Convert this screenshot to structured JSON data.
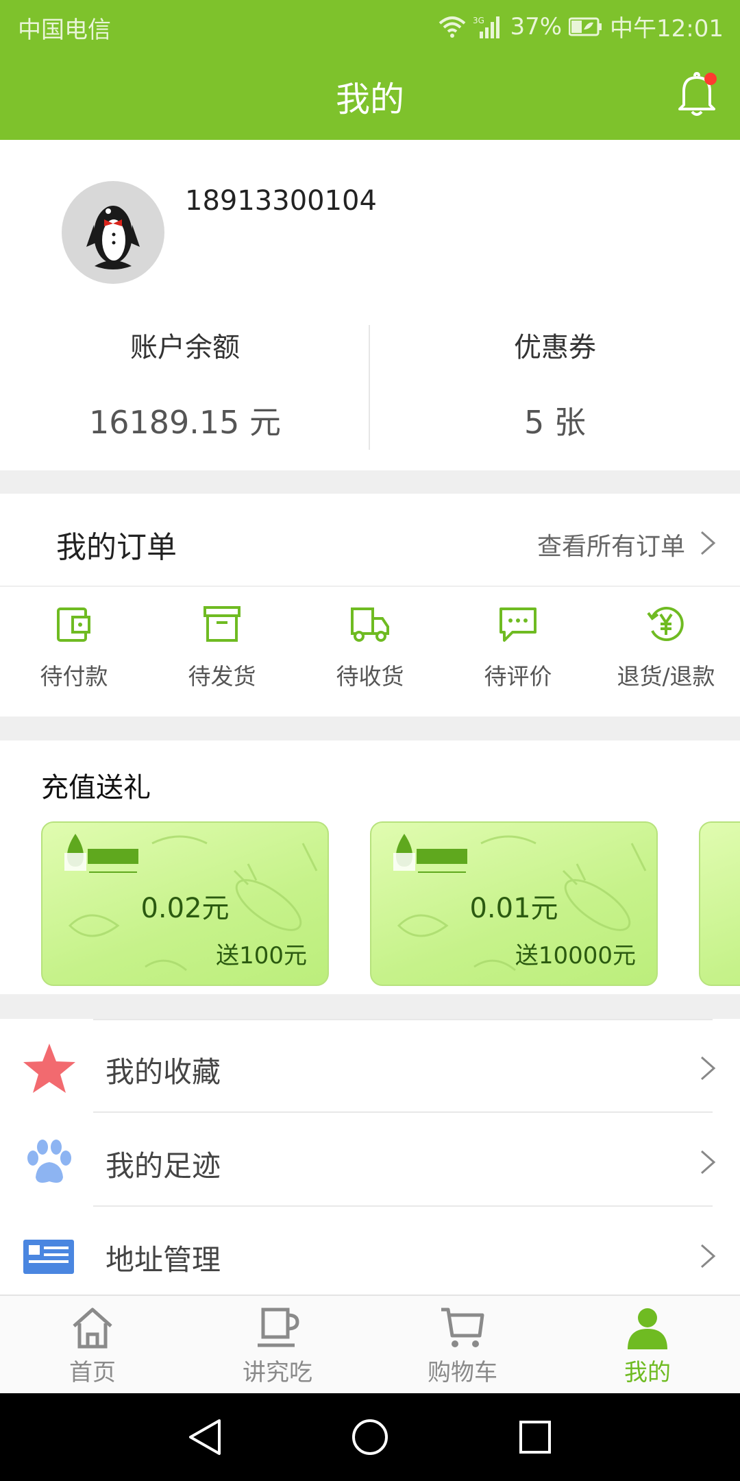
{
  "status_bar": {
    "carrier": "中国电信",
    "network": "3G",
    "battery": "37%",
    "time": "中午12:01"
  },
  "header": {
    "title": "我的",
    "notification_dot_color": "#ff3b30"
  },
  "profile": {
    "phone": "18913300104",
    "balance_label": "账户余额",
    "balance_value": "16189.15 元",
    "coupon_label": "优惠券",
    "coupon_value": "5 张"
  },
  "orders": {
    "title": "我的订单",
    "view_all": "查看所有订单",
    "items": [
      {
        "label": "待付款",
        "icon": "wallet-icon"
      },
      {
        "label": "待发货",
        "icon": "box-icon"
      },
      {
        "label": "待收货",
        "icon": "truck-icon"
      },
      {
        "label": "待评价",
        "icon": "comment-icon"
      },
      {
        "label": "退货/退款",
        "icon": "refund-yen-icon"
      }
    ]
  },
  "recharge": {
    "title": "充值送礼",
    "cards": [
      {
        "amount": "0.02元",
        "gift": "送100元"
      },
      {
        "amount": "0.01元",
        "gift": "送10000元"
      }
    ]
  },
  "menu": [
    {
      "label": "我的收藏",
      "icon": "star-icon"
    },
    {
      "label": "我的足迹",
      "icon": "paw-icon"
    },
    {
      "label": "地址管理",
      "icon": "address-card-icon"
    }
  ],
  "tabbar": {
    "tabs": [
      {
        "label": "首页",
        "icon": "home-icon"
      },
      {
        "label": "讲究吃",
        "icon": "cup-icon"
      },
      {
        "label": "购物车",
        "icon": "cart-icon"
      },
      {
        "label": "我的",
        "icon": "user-icon"
      }
    ],
    "active_index": 3
  },
  "colors": {
    "brand": "#7ec22c",
    "active_tab": "#6fbb22"
  }
}
